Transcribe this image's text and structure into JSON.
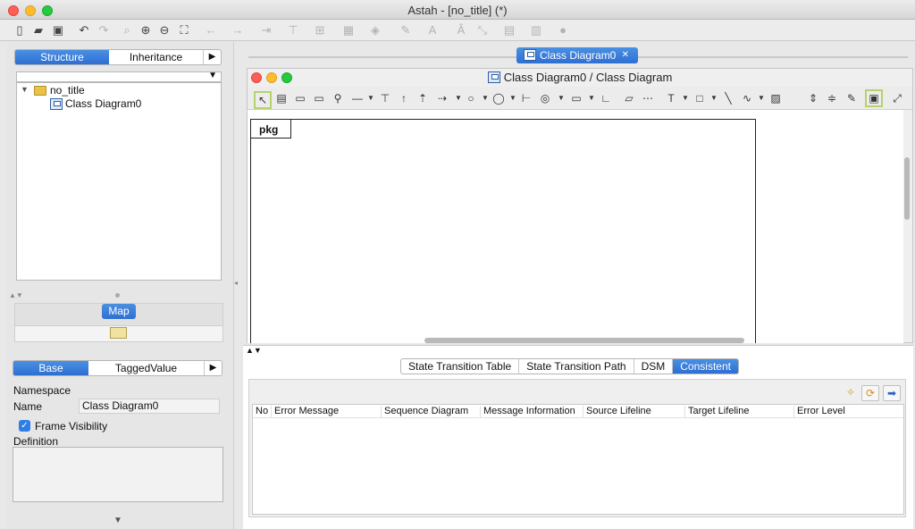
{
  "window": {
    "title": "Astah - [no_title] (*)"
  },
  "left": {
    "top_tabs": [
      "Structure",
      "Inheritance"
    ],
    "tree": {
      "root": "no_title",
      "child": "Class Diagram0"
    },
    "map_label": "Map",
    "prop_tabs": [
      "Base",
      "TaggedValue"
    ],
    "namespace_label": "Namespace",
    "name_label": "Name",
    "name_value": "Class Diagram0",
    "frame_visibility_label": "Frame Visibility",
    "definition_label": "Definition"
  },
  "editor": {
    "doc_tab": "Class Diagram0",
    "inner_title": "Class Diagram0 / Class Diagram",
    "frame_label": "pkg"
  },
  "bottom": {
    "tabs": [
      "State Transition Table",
      "State Transition Path",
      "DSM",
      "Consistent"
    ],
    "active_tab": "Consistent",
    "columns": [
      "No",
      "Error Message",
      "Sequence Diagram",
      "Message Information",
      "Source Lifeline",
      "Target Lifeline",
      "Error Level"
    ]
  },
  "colors": {
    "accent": "#2e6fd3",
    "folder": "#e9c24a"
  }
}
